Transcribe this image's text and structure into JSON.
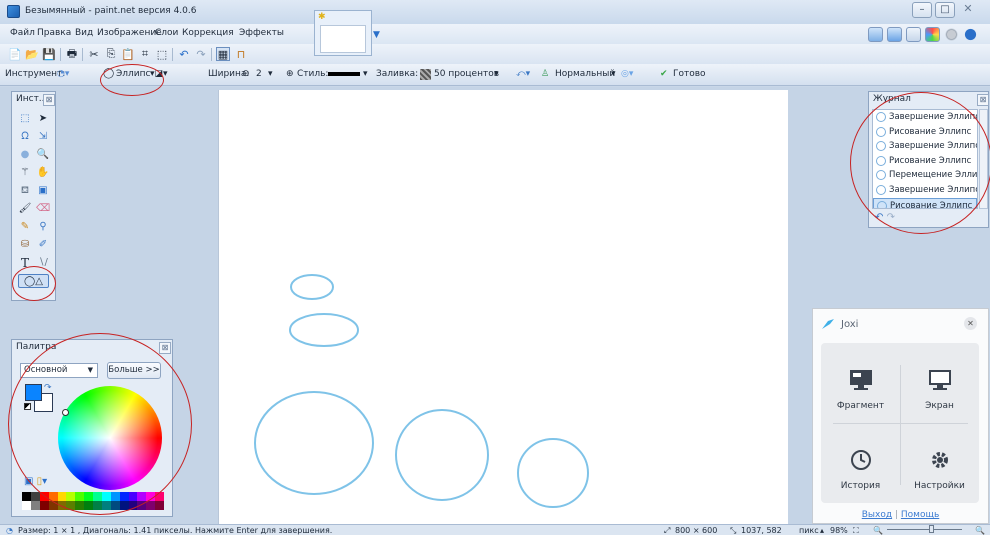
{
  "window": {
    "title": "Безымянный - paint.net версия 4.0.6",
    "minimize": "–",
    "maximize": "□",
    "close": "✕"
  },
  "menu": {
    "items": [
      "Файл",
      "Правка",
      "Вид",
      "Изображение",
      "Слои",
      "Коррекция",
      "Эффекты"
    ]
  },
  "options": {
    "tool_label": "Инструмент:",
    "shape_value": "Эллипс",
    "width_label": "Ширина:",
    "width_value": "2",
    "style_label": "Стиль:",
    "fill_label": "Заливка:",
    "fill_value": "50 процентов",
    "blend_value": "Нормальный",
    "done_label": "Готово"
  },
  "tools_panel": {
    "title": "Инст..."
  },
  "journal": {
    "title": "Журнал",
    "items": [
      "Завершение Эллипс",
      "Рисование Эллипс",
      "Завершение Эллипс",
      "Рисование Эллипс",
      "Перемещение Эллипс",
      "Завершение Эллипс",
      "Рисование Эллипс"
    ],
    "selected_index": 6
  },
  "palette": {
    "title": "Палитра",
    "mode_value": "Основной",
    "more_label": "Больше >>",
    "primary_color": "#0a84ff",
    "secondary_color": "#ffffff",
    "swatches": [
      "#000000",
      "#404040",
      "#ff0000",
      "#ff6a00",
      "#ffd800",
      "#b6ff00",
      "#4cff00",
      "#00ff21",
      "#00ff90",
      "#00ffff",
      "#0094ff",
      "#0026ff",
      "#4800ff",
      "#b200ff",
      "#ff00dc",
      "#ff006e",
      "#ffffff",
      "#808080",
      "#7f0000",
      "#7f3300",
      "#7f6a00",
      "#5b7f00",
      "#267f00",
      "#007f0e",
      "#007f46",
      "#007f7f",
      "#004a7f",
      "#00137f",
      "#21007f",
      "#57007f",
      "#7f006e",
      "#7f0037"
    ]
  },
  "joxi": {
    "title": "Joxi",
    "cells": [
      "Фрагмент",
      "Экран",
      "История",
      "Настройки"
    ],
    "logout": "Выход",
    "help": "Помощь",
    "separator": "|"
  },
  "status": {
    "info": "Размер: 1 × 1 , Диагональ: 1.41 пикселы. Нажмите Enter для завершения.",
    "image_size": "800 × 600",
    "cursor_pos": "1037, 582",
    "units": "пикс",
    "zoom": "98%"
  },
  "colors": {
    "accent": "#3b7bd1",
    "ellipse_stroke": "#7fc3e8",
    "annotation": "#c62222"
  }
}
